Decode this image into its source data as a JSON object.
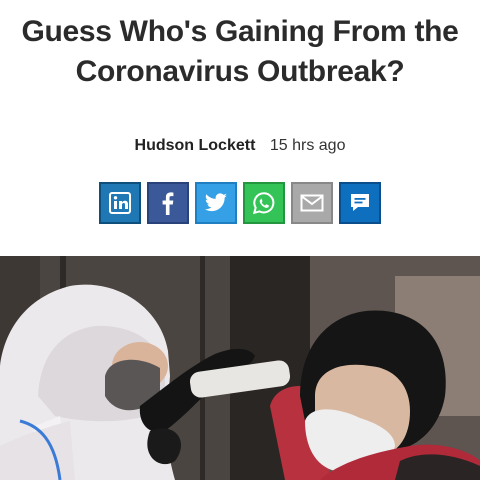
{
  "article": {
    "title_line1": "Guess Who's Gaining From the",
    "title_line2": "Coronavirus Outbreak?",
    "author": "Hudson Lockett",
    "time": "15 hrs ago"
  },
  "share": [
    {
      "name": "linkedin-icon",
      "color": "#1f77b4"
    },
    {
      "name": "facebook-icon",
      "color": "#3b5998"
    },
    {
      "name": "twitter-icon",
      "color": "#35a0e6"
    },
    {
      "name": "whatsapp-icon",
      "color": "#33c357"
    },
    {
      "name": "email-icon",
      "color": "#a9a9a9"
    },
    {
      "name": "comment-icon",
      "color": "#0f6fbf"
    }
  ],
  "colors": {
    "headline": "#2b2b2b",
    "background": "#ffffff"
  }
}
